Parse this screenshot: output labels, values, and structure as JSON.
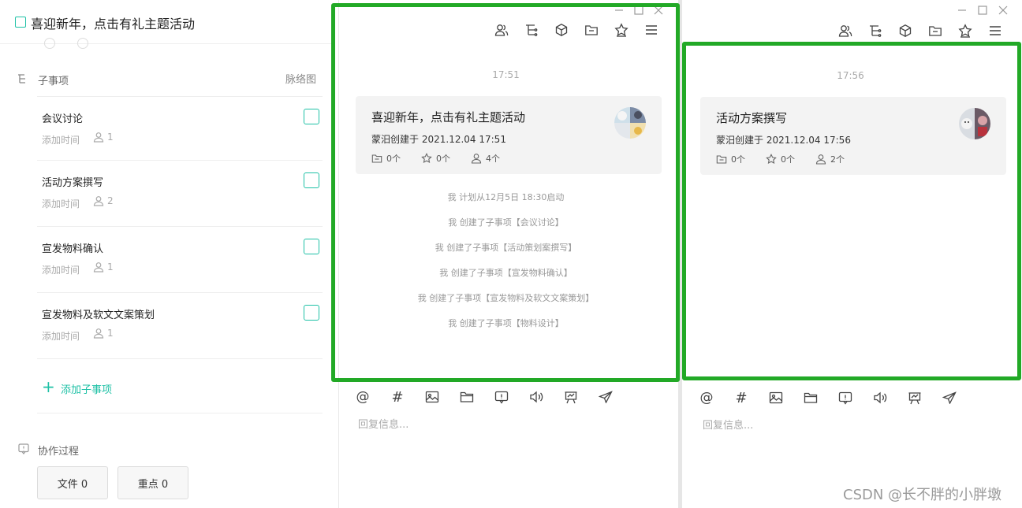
{
  "task": {
    "title": "喜迎新年，点击有礼主题活动"
  },
  "subtasks": {
    "section_label": "子事项",
    "mindmap_label": "脉络图",
    "items": [
      {
        "title": "会议讨论",
        "meta": "添加时间",
        "people": "1"
      },
      {
        "title": "活动方案撰写",
        "meta": "添加时间",
        "people": "2"
      },
      {
        "title": "宣发物料确认",
        "meta": "添加时间",
        "people": "1"
      },
      {
        "title": "宣发物料及软文文案策划",
        "meta": "添加时间",
        "people": "1"
      }
    ],
    "add_label": "添加子事项"
  },
  "collab": {
    "label": "协作过程",
    "file_button": "文件 0",
    "key_button": "重点 0"
  },
  "chat_main": {
    "time": "17:51",
    "card": {
      "title": "喜迎新年，点击有礼主题活动",
      "creator": "蒙汨创建于",
      "created_at": "2021.12.04 17:51",
      "files": "0个",
      "stars": "0个",
      "people": "4个"
    },
    "log": [
      "我 计划从12月5日 18:30启动",
      "我 创建了子事项【会议讨论】",
      "我 创建了子事项【活动策划案撰写】",
      "我 创建了子事项【宣发物料确认】",
      "我 创建了子事项【宣发物料及软文文案策划】",
      "我 创建了子事项【物料设计】"
    ],
    "reply_placeholder": "回复信息..."
  },
  "chat_sub": {
    "time": "17:56",
    "card": {
      "title": "活动方案撰写",
      "creator": "蒙汨创建于",
      "created_at": "2021.12.04 17:56",
      "files": "0个",
      "stars": "0个",
      "people": "2个"
    },
    "reply_placeholder": "回复信息..."
  },
  "watermark": "CSDN @长不胖的小胖墩",
  "colors": {
    "accent": "#1fc1a6",
    "highlight_frame": "#22a926"
  },
  "icons": {
    "toolbar": [
      "members-icon",
      "tree-icon",
      "cube-icon",
      "folder-icon",
      "star-icon",
      "menu-icon"
    ],
    "compose": [
      "mention-icon",
      "hashtag-icon",
      "image-icon",
      "folder-icon",
      "comment-icon",
      "voice-icon",
      "whiteboard-icon",
      "send-icon"
    ]
  }
}
